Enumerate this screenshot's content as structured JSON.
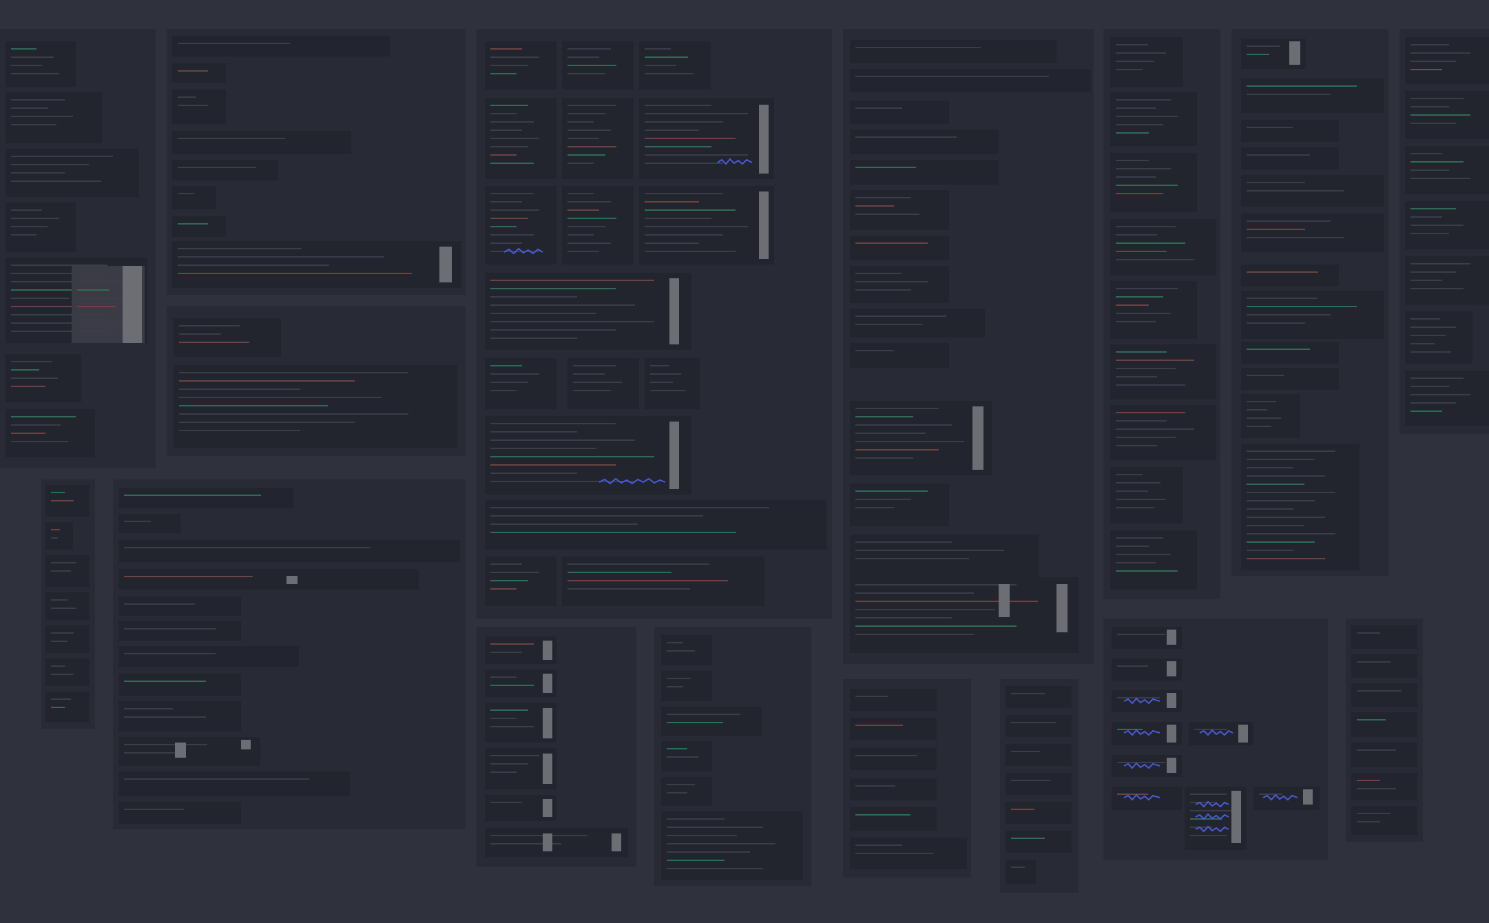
{
  "canvas": {
    "background": "#2f313d",
    "section_color": "#282a35",
    "frame_color": "#22242e",
    "accent_wave": "#4a5bd8",
    "accent_warm": "#a0584f",
    "accent_green": "#3f8c6a",
    "scrollbar": "#6d6e74"
  }
}
